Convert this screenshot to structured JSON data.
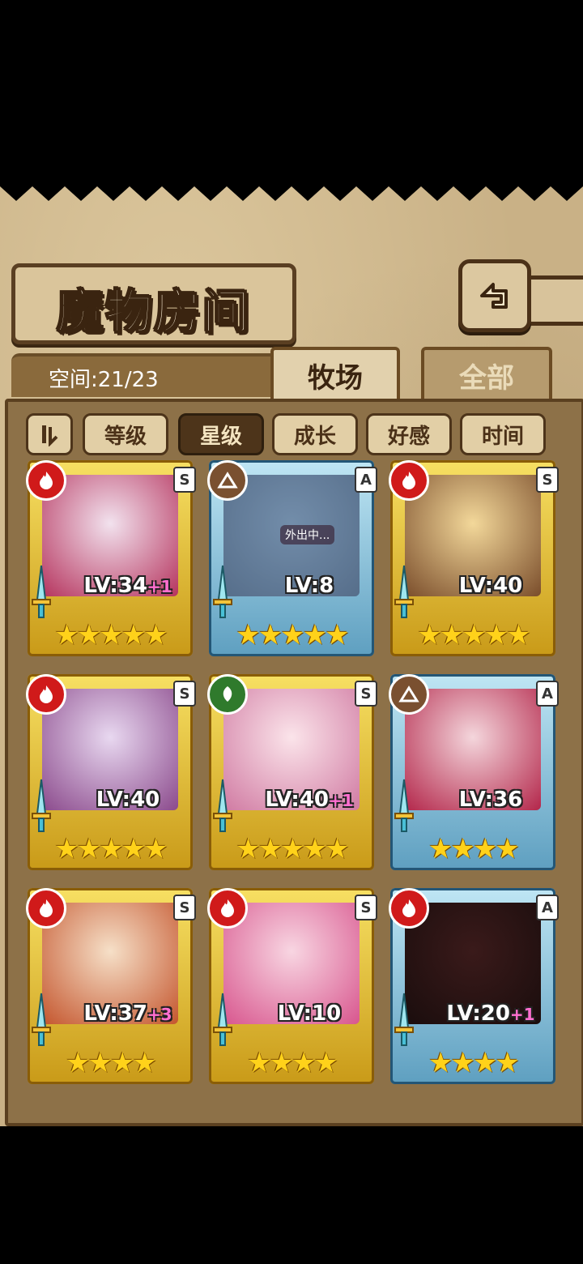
{
  "header": {
    "title": "魔物房间"
  },
  "space": {
    "text": "空间:21/23"
  },
  "tabs": [
    {
      "label": "牧场",
      "active": true
    },
    {
      "label": "全部",
      "active": false
    }
  ],
  "sort": {
    "buttons": [
      "等级",
      "星级",
      "成长",
      "好感",
      "时间"
    ],
    "active": "星级"
  },
  "colors": {
    "gold_frame": "#f1d140",
    "blue_frame": "#8cc7dc",
    "fire": "#d01a1a",
    "earth": "#7a5030",
    "wind": "#2f7a2c"
  },
  "cards": [
    {
      "element": "fire",
      "rank": "S",
      "level": "LV:34",
      "bonus": "+1",
      "stars": 5,
      "frame": "gold"
    },
    {
      "element": "earth",
      "rank": "A",
      "level": "LV:8",
      "bonus": "",
      "stars": 5,
      "frame": "blue",
      "status": "外出中..."
    },
    {
      "element": "fire",
      "rank": "S",
      "level": "LV:40",
      "bonus": "",
      "stars": 5,
      "frame": "gold"
    },
    {
      "element": "fire",
      "rank": "S",
      "level": "LV:40",
      "bonus": "",
      "stars": 5,
      "frame": "gold"
    },
    {
      "element": "wind",
      "rank": "S",
      "level": "LV:40",
      "bonus": "+1",
      "stars": 5,
      "frame": "gold"
    },
    {
      "element": "earth",
      "rank": "A",
      "level": "LV:36",
      "bonus": "",
      "stars": 4,
      "frame": "blue"
    },
    {
      "element": "fire",
      "rank": "S",
      "level": "LV:37",
      "bonus": "+3",
      "stars": 4,
      "frame": "gold"
    },
    {
      "element": "fire",
      "rank": "S",
      "level": "LV:10",
      "bonus": "",
      "stars": 4,
      "frame": "gold"
    },
    {
      "element": "fire",
      "rank": "A",
      "level": "LV:20",
      "bonus": "+1",
      "stars": 4,
      "frame": "blue"
    }
  ]
}
